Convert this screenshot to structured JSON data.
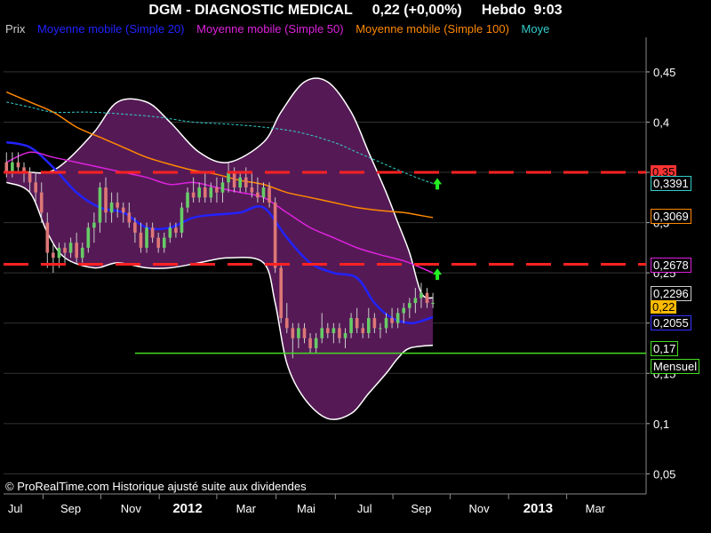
{
  "header": {
    "title": "DGM - DIAGNOSTIC MEDICAL",
    "price": "0,22 (+0,00%)",
    "period": "Hebdo",
    "time": "9:03"
  },
  "legend": [
    {
      "label": "Prix",
      "color": "#cccccc"
    },
    {
      "label": "Moyenne mobile (Simple 20)",
      "color": "#2222ff"
    },
    {
      "label": "Moyenne mobile (Simple 50)",
      "color": "#dd22dd"
    },
    {
      "label": "Moyenne mobile (Simple 100)",
      "color": "#ff8800"
    },
    {
      "label": "Moye",
      "color": "#33cccc"
    }
  ],
  "copyright": "© ProRealTime.com Historique ajusté suite aux dividendes",
  "colors": {
    "background": "#000000",
    "band_fill": "#551a55",
    "band_edge": "#ffffff",
    "bull": "#66cc66",
    "bear": "#dd7777",
    "resistance": "#ff2222",
    "support": "#44dd22",
    "grid": "#333333"
  },
  "chart_data": {
    "type": "candlestick",
    "ylim": [
      0.03,
      0.48
    ],
    "y_ticks": [
      "0,45",
      "0,4",
      "0,35",
      "0,3",
      "0,25",
      "0,2",
      "0,15",
      "0,1",
      "0,05"
    ],
    "y_tick_values": [
      0.45,
      0.4,
      0.35,
      0.3,
      0.25,
      0.2,
      0.15,
      0.1,
      0.05
    ],
    "x_ticks": [
      "Jul",
      "Sep",
      "Nov",
      "2012",
      "Mar",
      "Mai",
      "Jul",
      "Sep",
      "Nov",
      "2013",
      "Mar"
    ],
    "x_tick_bold": [
      false,
      false,
      false,
      true,
      false,
      false,
      false,
      false,
      false,
      true,
      false
    ],
    "x_tick_index": [
      1.5,
      11,
      21.3,
      31,
      41,
      51.3,
      61.3,
      71,
      80.9,
      91,
      100.8
    ],
    "n_slots": 110,
    "candles": [
      [
        0.36,
        0.37,
        0.345,
        0.35
      ],
      [
        0.35,
        0.37,
        0.345,
        0.36
      ],
      [
        0.36,
        0.37,
        0.35,
        0.355
      ],
      [
        0.355,
        0.36,
        0.34,
        0.35
      ],
      [
        0.35,
        0.355,
        0.33,
        0.34
      ],
      [
        0.34,
        0.35,
        0.32,
        0.33
      ],
      [
        0.33,
        0.34,
        0.3,
        0.31
      ],
      [
        0.3,
        0.31,
        0.255,
        0.27
      ],
      [
        0.27,
        0.28,
        0.25,
        0.265
      ],
      [
        0.265,
        0.28,
        0.255,
        0.275
      ],
      [
        0.275,
        0.28,
        0.26,
        0.27
      ],
      [
        0.27,
        0.285,
        0.265,
        0.28
      ],
      [
        0.28,
        0.29,
        0.26,
        0.265
      ],
      [
        0.265,
        0.28,
        0.26,
        0.275
      ],
      [
        0.275,
        0.3,
        0.27,
        0.295
      ],
      [
        0.295,
        0.31,
        0.28,
        0.3
      ],
      [
        0.3,
        0.34,
        0.29,
        0.335
      ],
      [
        0.335,
        0.345,
        0.3,
        0.31
      ],
      [
        0.31,
        0.33,
        0.3,
        0.32
      ],
      [
        0.32,
        0.33,
        0.305,
        0.315
      ],
      [
        0.315,
        0.32,
        0.3,
        0.31
      ],
      [
        0.31,
        0.32,
        0.295,
        0.3
      ],
      [
        0.3,
        0.305,
        0.28,
        0.29
      ],
      [
        0.29,
        0.3,
        0.27,
        0.275
      ],
      [
        0.275,
        0.3,
        0.27,
        0.295
      ],
      [
        0.295,
        0.3,
        0.28,
        0.285
      ],
      [
        0.285,
        0.29,
        0.27,
        0.275
      ],
      [
        0.275,
        0.29,
        0.27,
        0.285
      ],
      [
        0.285,
        0.3,
        0.28,
        0.295
      ],
      [
        0.295,
        0.3,
        0.285,
        0.29
      ],
      [
        0.29,
        0.32,
        0.285,
        0.315
      ],
      [
        0.315,
        0.335,
        0.31,
        0.33
      ],
      [
        0.33,
        0.345,
        0.32,
        0.325
      ],
      [
        0.325,
        0.34,
        0.32,
        0.335
      ],
      [
        0.335,
        0.35,
        0.32,
        0.325
      ],
      [
        0.325,
        0.34,
        0.32,
        0.335
      ],
      [
        0.335,
        0.345,
        0.32,
        0.33
      ],
      [
        0.33,
        0.345,
        0.32,
        0.34
      ],
      [
        0.34,
        0.36,
        0.33,
        0.35
      ],
      [
        0.35,
        0.355,
        0.33,
        0.335
      ],
      [
        0.335,
        0.35,
        0.33,
        0.345
      ],
      [
        0.345,
        0.355,
        0.33,
        0.335
      ],
      [
        0.335,
        0.35,
        0.325,
        0.33
      ],
      [
        0.33,
        0.345,
        0.32,
        0.325
      ],
      [
        0.325,
        0.34,
        0.32,
        0.335
      ],
      [
        0.335,
        0.34,
        0.315,
        0.32
      ],
      [
        0.32,
        0.325,
        0.25,
        0.255
      ],
      [
        0.255,
        0.26,
        0.2,
        0.205
      ],
      [
        0.205,
        0.22,
        0.19,
        0.195
      ],
      [
        0.195,
        0.2,
        0.165,
        0.185
      ],
      [
        0.185,
        0.2,
        0.175,
        0.195
      ],
      [
        0.195,
        0.2,
        0.18,
        0.185
      ],
      [
        0.185,
        0.19,
        0.17,
        0.175
      ],
      [
        0.175,
        0.19,
        0.17,
        0.185
      ],
      [
        0.185,
        0.21,
        0.18,
        0.195
      ],
      [
        0.195,
        0.2,
        0.185,
        0.19
      ],
      [
        0.19,
        0.2,
        0.18,
        0.195
      ],
      [
        0.195,
        0.2,
        0.18,
        0.185
      ],
      [
        0.185,
        0.195,
        0.175,
        0.19
      ],
      [
        0.19,
        0.21,
        0.185,
        0.205
      ],
      [
        0.205,
        0.215,
        0.19,
        0.195
      ],
      [
        0.195,
        0.2,
        0.185,
        0.19
      ],
      [
        0.19,
        0.215,
        0.185,
        0.205
      ],
      [
        0.205,
        0.21,
        0.19,
        0.195
      ],
      [
        0.195,
        0.2,
        0.185,
        0.195
      ],
      [
        0.195,
        0.21,
        0.19,
        0.205
      ],
      [
        0.205,
        0.215,
        0.195,
        0.2
      ],
      [
        0.2,
        0.215,
        0.195,
        0.21
      ],
      [
        0.21,
        0.22,
        0.2,
        0.215
      ],
      [
        0.215,
        0.225,
        0.205,
        0.22
      ],
      [
        0.22,
        0.235,
        0.21,
        0.225
      ],
      [
        0.225,
        0.24,
        0.215,
        0.23
      ],
      [
        0.23,
        0.235,
        0.215,
        0.22
      ],
      [
        0.22,
        0.23,
        0.215,
        0.22
      ]
    ],
    "bollinger_upper": [
      [
        0,
        0.35
      ],
      [
        4,
        0.35
      ],
      [
        7,
        0.35
      ],
      [
        10,
        0.36
      ],
      [
        15,
        0.39
      ],
      [
        19,
        0.42
      ],
      [
        24,
        0.42
      ],
      [
        28,
        0.4
      ],
      [
        33,
        0.37
      ],
      [
        38,
        0.36
      ],
      [
        44,
        0.38
      ],
      [
        47,
        0.41
      ],
      [
        51,
        0.44
      ],
      [
        55,
        0.44
      ],
      [
        59,
        0.41
      ],
      [
        62,
        0.37
      ],
      [
        65,
        0.33
      ],
      [
        67,
        0.3
      ],
      [
        69,
        0.27
      ],
      [
        71,
        0.23
      ],
      [
        73,
        0.225
      ]
    ],
    "bollinger_lower": [
      [
        0,
        0.34
      ],
      [
        4,
        0.33
      ],
      [
        7,
        0.29
      ],
      [
        10,
        0.265
      ],
      [
        15,
        0.255
      ],
      [
        19,
        0.26
      ],
      [
        24,
        0.255
      ],
      [
        28,
        0.255
      ],
      [
        33,
        0.26
      ],
      [
        38,
        0.265
      ],
      [
        44,
        0.26
      ],
      [
        46,
        0.22
      ],
      [
        48,
        0.16
      ],
      [
        51,
        0.125
      ],
      [
        55,
        0.105
      ],
      [
        59,
        0.11
      ],
      [
        62,
        0.13
      ],
      [
        65,
        0.15
      ],
      [
        67,
        0.165
      ],
      [
        69,
        0.175
      ],
      [
        73,
        0.178
      ]
    ],
    "series": [
      {
        "name": "Moyenne mobile (Simple 20)",
        "color": "#2222ff",
        "points": [
          [
            0,
            0.38
          ],
          [
            4,
            0.375
          ],
          [
            8,
            0.355
          ],
          [
            12,
            0.33
          ],
          [
            16,
            0.315
          ],
          [
            20,
            0.31
          ],
          [
            24,
            0.295
          ],
          [
            28,
            0.295
          ],
          [
            32,
            0.305
          ],
          [
            36,
            0.308
          ],
          [
            40,
            0.31
          ],
          [
            44,
            0.315
          ],
          [
            48,
            0.285
          ],
          [
            52,
            0.26
          ],
          [
            56,
            0.25
          ],
          [
            60,
            0.245
          ],
          [
            63,
            0.22
          ],
          [
            66,
            0.205
          ],
          [
            69,
            0.2
          ],
          [
            71,
            0.202
          ],
          [
            73,
            0.206
          ]
        ]
      },
      {
        "name": "Moyenne mobile (Simple 50)",
        "color": "#dd22dd",
        "points": [
          [
            0,
            0.36
          ],
          [
            4,
            0.37
          ],
          [
            8,
            0.365
          ],
          [
            12,
            0.36
          ],
          [
            16,
            0.355
          ],
          [
            20,
            0.35
          ],
          [
            24,
            0.345
          ],
          [
            28,
            0.338
          ],
          [
            32,
            0.34
          ],
          [
            36,
            0.335
          ],
          [
            40,
            0.33
          ],
          [
            44,
            0.325
          ],
          [
            48,
            0.31
          ],
          [
            52,
            0.295
          ],
          [
            56,
            0.285
          ],
          [
            60,
            0.275
          ],
          [
            64,
            0.268
          ],
          [
            68,
            0.262
          ],
          [
            71,
            0.255
          ],
          [
            73,
            0.25
          ]
        ]
      },
      {
        "name": "Moyenne mobile (Simple 100)",
        "color": "#ff8800",
        "points": [
          [
            0,
            0.43
          ],
          [
            4,
            0.42
          ],
          [
            8,
            0.41
          ],
          [
            12,
            0.395
          ],
          [
            16,
            0.385
          ],
          [
            20,
            0.375
          ],
          [
            24,
            0.365
          ],
          [
            28,
            0.358
          ],
          [
            32,
            0.352
          ],
          [
            36,
            0.348
          ],
          [
            40,
            0.342
          ],
          [
            44,
            0.338
          ],
          [
            48,
            0.33
          ],
          [
            52,
            0.325
          ],
          [
            56,
            0.32
          ],
          [
            60,
            0.315
          ],
          [
            64,
            0.312
          ],
          [
            68,
            0.31
          ],
          [
            71,
            0.307
          ],
          [
            73,
            0.305
          ]
        ]
      },
      {
        "name": "Moye",
        "color": "#33cccc",
        "points": [
          [
            0,
            0.42
          ],
          [
            4,
            0.415
          ],
          [
            8,
            0.41
          ],
          [
            14,
            0.41
          ],
          [
            20,
            0.408
          ],
          [
            26,
            0.405
          ],
          [
            32,
            0.4
          ],
          [
            38,
            0.398
          ],
          [
            44,
            0.395
          ],
          [
            50,
            0.39
          ],
          [
            56,
            0.38
          ],
          [
            60,
            0.37
          ],
          [
            64,
            0.36
          ],
          [
            68,
            0.35
          ],
          [
            71,
            0.343
          ],
          [
            73,
            0.339
          ]
        ]
      }
    ],
    "lines": [
      {
        "name": "resistance-upper",
        "y": 0.35,
        "color": "#ff2222",
        "dashed": true
      },
      {
        "name": "resistance-lower",
        "y": 0.2585,
        "color": "#ff2222",
        "dashed": true
      },
      {
        "name": "support-monthly",
        "y": 0.17,
        "color": "#44dd22",
        "dashed": false,
        "from": 22
      }
    ],
    "arrows": [
      [
        73,
        0.34
      ],
      [
        73,
        0.25
      ]
    ],
    "price_tags": [
      {
        "text": "0,35",
        "y": 0.35,
        "bg": "#ff3333",
        "fg": "#000000"
      },
      {
        "text": "0,3391",
        "y": 0.3391,
        "bg": "#000000",
        "fg": "#ffffff",
        "border": "#33cccc"
      },
      {
        "text": "0,3069",
        "y": 0.3069,
        "bg": "#000000",
        "fg": "#ffffff",
        "border": "#ff8800"
      },
      {
        "text": "0,2678",
        "y": 0.2585,
        "bg": "#000000",
        "fg": "#ffffff",
        "border": "#dd22dd"
      },
      {
        "text": "0,2296",
        "y": 0.2296,
        "bg": "#000000",
        "fg": "#ffffff",
        "border": "#cccccc"
      },
      {
        "text": "0,22",
        "y": 0.2155,
        "bg": "#ffbb00",
        "fg": "#000000"
      },
      {
        "text": "0,2055",
        "y": 0.2007,
        "bg": "#000000",
        "fg": "#ffffff",
        "border": "#3333ff"
      },
      {
        "text": "0,17",
        "y": 0.175,
        "bg": "#000000",
        "fg": "#ffffff",
        "border": "#44dd22"
      },
      {
        "text": "Mensuel",
        "y": 0.157,
        "bg": "#000000",
        "fg": "#ffffff",
        "border": "#44dd22"
      }
    ]
  }
}
